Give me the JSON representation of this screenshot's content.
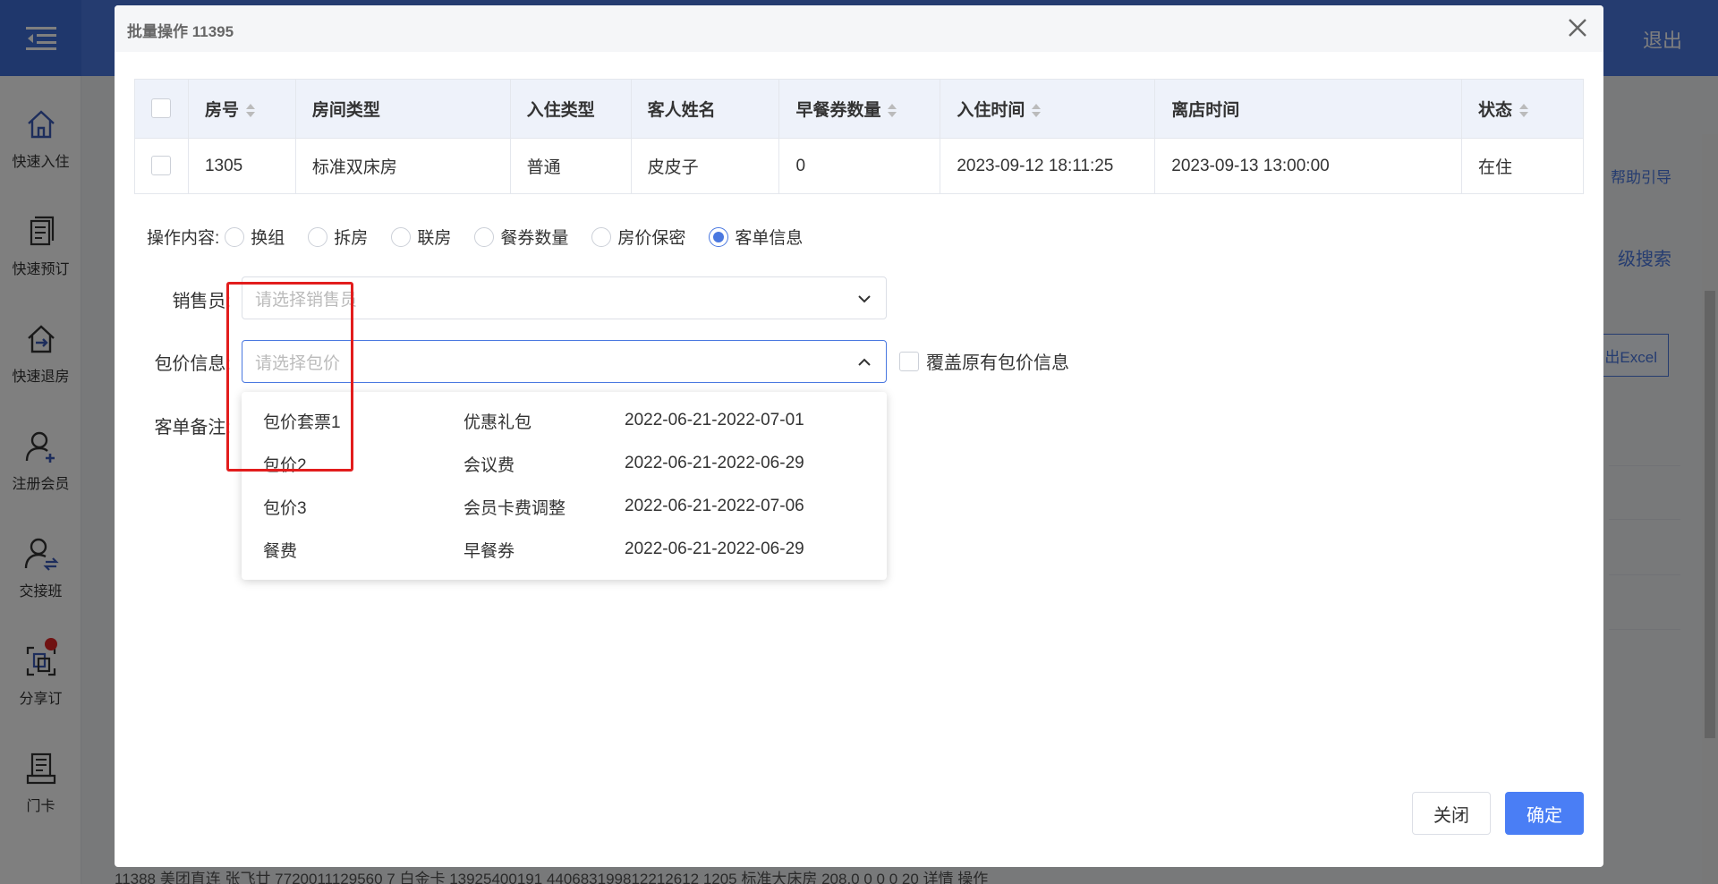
{
  "window": {
    "title": "批量操作 11395",
    "exit_label": "退出"
  },
  "sidebar": {
    "items": [
      {
        "label": "快速入住",
        "icon": "home-icon"
      },
      {
        "label": "快速预订",
        "icon": "document-icon"
      },
      {
        "label": "快速退房",
        "icon": "checkout-icon"
      },
      {
        "label": "注册会员",
        "icon": "add-user-icon"
      },
      {
        "label": "交接班",
        "icon": "shift-handover-icon"
      },
      {
        "label": "分享订",
        "icon": "share-order-icon"
      },
      {
        "label": "门卡",
        "icon": "door-card-icon"
      }
    ]
  },
  "background": {
    "help_link": "帮助引导",
    "search_link": "级搜索",
    "excel_button": "出Excel",
    "bottom_row": "11388   美团直连        张飞廿   7720011129560 7   白金卡        13925400191   440683199812212612   1205      标准大床房     208.0           0              0           0   20  详情   操作"
  },
  "table": {
    "headers": [
      "房号",
      "房间类型",
      "入住类型",
      "客人姓名",
      "早餐券数量",
      "入住时间",
      "离店时间",
      "状态"
    ],
    "rows": [
      [
        "1305",
        "标准双床房",
        "普通",
        "皮皮子",
        "0",
        "2023-09-12 18:11:25",
        "2023-09-13 13:00:00",
        "在住"
      ]
    ]
  },
  "operation": {
    "label": "操作内容:",
    "options": [
      "换组",
      "拆房",
      "联房",
      "餐券数量",
      "房价保密",
      "客单信息"
    ],
    "selected": "客单信息"
  },
  "form": {
    "salesperson_label": "销售员:",
    "salesperson_placeholder": "请选择销售员",
    "package_label": "包价信息:",
    "package_placeholder": "请选择包价",
    "remark_label": "客单备注:",
    "cover_label": "覆盖原有包价信息"
  },
  "package_options": [
    {
      "name": "包价套票1",
      "item": "优惠礼包",
      "dates": "2022-06-21-2022-07-01"
    },
    {
      "name": "包价2",
      "item": "会议费",
      "dates": "2022-06-21-2022-06-29"
    },
    {
      "name": "包价3",
      "item": "会员卡费调整",
      "dates": "2022-06-21-2022-07-06"
    },
    {
      "name": "餐费",
      "item": "早餐券",
      "dates": "2022-06-21-2022-06-29"
    }
  ],
  "buttons": {
    "close": "关闭",
    "confirm": "确定"
  },
  "colors": {
    "accent": "#4a78e0",
    "highlight_box": "#e21d1d",
    "badge": "#e02424"
  }
}
